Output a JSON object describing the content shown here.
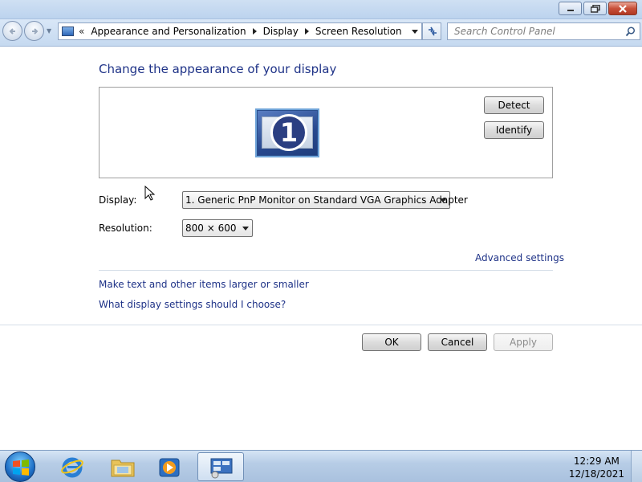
{
  "window": {
    "caption_buttons": [
      "minimize",
      "restore",
      "close"
    ]
  },
  "nav": {
    "history_chevron": "«",
    "breadcrumbs": [
      "Appearance and Personalization",
      "Display",
      "Screen Resolution"
    ],
    "search_placeholder": "Search Control Panel"
  },
  "content": {
    "heading": "Change the appearance of your display",
    "monitor_number": "1",
    "detect_label": "Detect",
    "identify_label": "Identify",
    "display_label": "Display:",
    "display_value": "1. Generic PnP Monitor on Standard VGA Graphics Adapter",
    "resolution_label": "Resolution:",
    "resolution_value": "800 × 600",
    "advanced_link": "Advanced settings",
    "text_size_link": "Make text and other items larger or smaller",
    "what_settings_link": "What display settings should I choose?"
  },
  "actions": {
    "ok_label": "OK",
    "cancel_label": "Cancel",
    "apply_label": "Apply"
  },
  "taskbar": {
    "items": [
      "start",
      "internet-explorer",
      "windows-explorer",
      "media-player",
      "control-panel"
    ],
    "time": "12:29 AM",
    "date": "12/18/2021"
  },
  "colors": {
    "link": "#1e3287",
    "heading": "#1e3287",
    "taskbar": "#b7cde6"
  }
}
